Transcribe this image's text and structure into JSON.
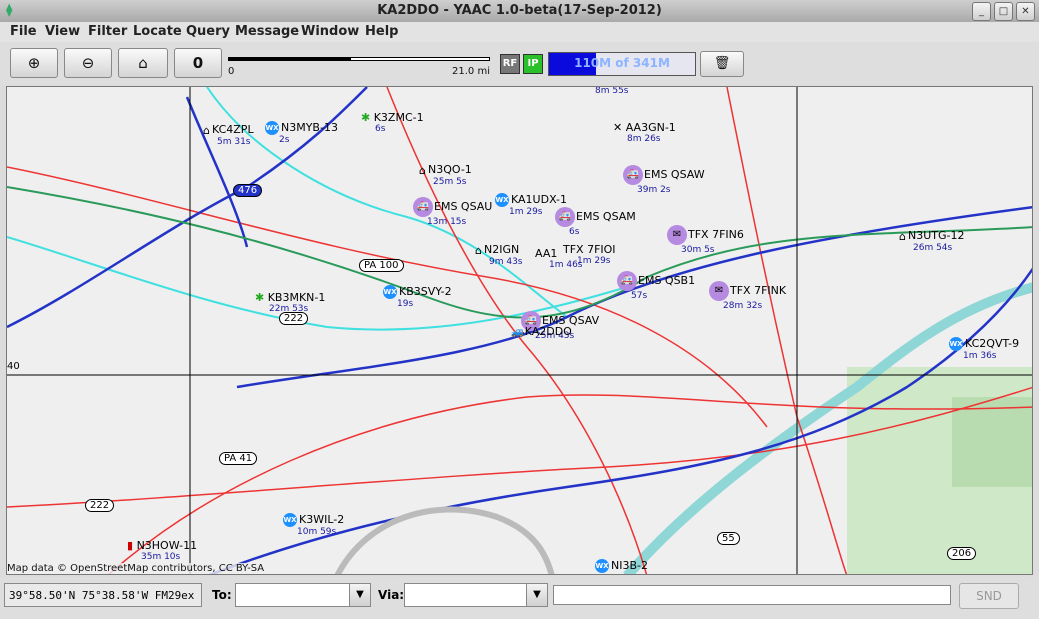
{
  "window": {
    "title": "KA2DDO - YAAC 1.0-beta(17-Sep-2012)",
    "buttons": [
      "minimize",
      "maximize",
      "close"
    ]
  },
  "menu": [
    "File",
    "View",
    "Filter",
    "Locate",
    "Query",
    "Message",
    "Window",
    "Help"
  ],
  "toolbar": {
    "zoom_in_icon": "⊕",
    "zoom_out_icon": "⊖",
    "home_icon": "⌂",
    "center_icon": "0",
    "scale_start": "0",
    "scale_end": "21.0 mi",
    "rf_label": "RF",
    "ip_label": "IP",
    "memory_text": "110M of 341M",
    "memory_used_fraction": 0.32,
    "trash_icon": "🗑"
  },
  "map": {
    "grid_label": "40",
    "attribution": "Map data © OpenStreetMap contributors, CC BY-SA",
    "road_labels": [
      "PA 100",
      "PA 41",
      "222",
      "222",
      "476",
      "55",
      "206"
    ],
    "stations": [
      {
        "name": "KC4ZPL",
        "age": "5m 31s",
        "icon": "house"
      },
      {
        "name": "N3MYB-13",
        "age": "2s",
        "icon": "wx"
      },
      {
        "name": "K3ZMC-1",
        "age": "6s",
        "icon": "star"
      },
      {
        "name": "N3QO-1",
        "age": "25m 5s",
        "icon": "house"
      },
      {
        "name": "EMS QSAU",
        "age": "13m 15s",
        "icon": "ems"
      },
      {
        "name": "KA1UDX-1",
        "age": "1m 29s",
        "icon": "wx"
      },
      {
        "name": "EMS QSAM",
        "age": "6s",
        "icon": "ems"
      },
      {
        "name": "EMS QSAW",
        "age": "39m 2s",
        "icon": "ems"
      },
      {
        "name": "AA3GN-1",
        "age": "8m 26s",
        "icon": "x"
      },
      {
        "name": "TFX 7FIN6",
        "age": "30m 5s",
        "icon": "ems"
      },
      {
        "name": "TFX 7FIOI",
        "age": "1m 29s",
        "icon": "ems"
      },
      {
        "name": "EMS QSB1",
        "age": "57s",
        "icon": "ems"
      },
      {
        "name": "TFX 7FINK",
        "age": "28m 32s",
        "icon": "ems"
      },
      {
        "name": "N3UTG-12",
        "age": "26m 54s",
        "icon": "house"
      },
      {
        "name": "KC2QVT-9",
        "age": "1m 36s",
        "icon": "wx"
      },
      {
        "name": "KB3SVY-2",
        "age": "19s",
        "icon": "wx"
      },
      {
        "name": "KB3MKN-1",
        "age": "22m 53s",
        "icon": "star"
      },
      {
        "name": "EMS QSAV",
        "age": "25m 43s",
        "icon": "ems"
      },
      {
        "name": "KA2DDO",
        "age": "",
        "icon": "car"
      },
      {
        "name": "K3WIL-2",
        "age": "10m 59s",
        "icon": "wx"
      },
      {
        "name": "N3HOW-11",
        "age": "35m 10s",
        "icon": "car"
      },
      {
        "name": "NI3B-2",
        "age": "",
        "icon": "wx"
      },
      {
        "name": "N2IGN",
        "age": "9m 43s",
        "icon": "house"
      },
      {
        "name": "AA1",
        "age": "1m 46s",
        "icon": "ems"
      }
    ],
    "top_age": "8m 55s"
  },
  "status": {
    "coords": "39°58.50'N 75°38.58'W FM29ex",
    "to_label": "To:",
    "to_value": "",
    "via_label": "Via:",
    "via_value": "",
    "message_value": "",
    "send_label": "SND"
  }
}
